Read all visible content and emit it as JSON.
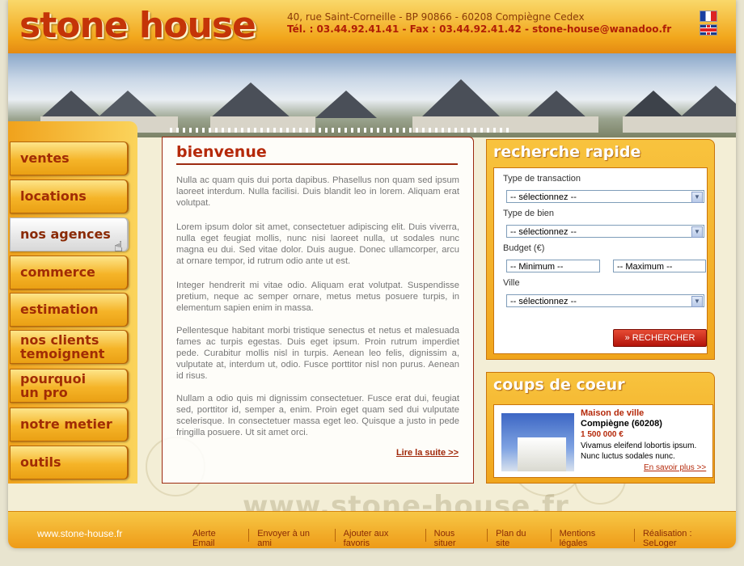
{
  "header": {
    "logo": "stone house",
    "address": "40, rue Saint-Corneille - BP 90866 - 60208 Compiègne Cedex",
    "contact": "Tél. : 03.44.92.41.41 - Fax : 03.44.92.41.42 - stone-house@wanadoo.fr",
    "flags": [
      "flag-fr",
      "flag-uk"
    ]
  },
  "nav": {
    "items": [
      {
        "label": "ventes"
      },
      {
        "label": "locations"
      },
      {
        "label": "nos agences"
      },
      {
        "label": "commerce"
      },
      {
        "label": "estimation"
      },
      {
        "label": "nos clients",
        "label2": "temoignent"
      },
      {
        "label": "pourquoi",
        "label2": "un pro"
      },
      {
        "label": "notre metier"
      },
      {
        "label": "outils"
      }
    ]
  },
  "main": {
    "title": "bienvenue",
    "paragraphs": [
      "Nulla ac quam quis dui porta dapibus. Phasellus non quam sed ipsum laoreet interdum. Nulla facilisi. Duis blandit leo in lorem. Aliquam erat volutpat.",
      "Lorem ipsum dolor sit amet, consectetuer adipiscing elit. Duis viverra, nulla eget feugiat mollis, nunc nisi laoreet nulla, ut sodales nunc magna eu dui. Sed vitae dolor. Duis augue. Donec ullamcorper, arcu at ornare tempor, id rutrum odio ante ut est.",
      "Integer hendrerit mi vitae odio. Aliquam erat volutpat. Suspendisse pretium, neque ac semper ornare, metus metus posuere turpis, in elementum sapien enim in massa.",
      "Pellentesque habitant morbi tristique senectus et netus et malesuada fames ac turpis egestas. Duis eget ipsum. Proin rutrum imperdiet pede. Curabitur mollis nisl in turpis. Aenean leo felis, dignissim a, vulputate at, interdum ut, odio. Fusce porttitor nisl non purus. Aenean id risus.",
      "Nullam a odio quis mi dignissim consectetuer. Fusce erat dui, feugiat sed, porttitor id, semper a, enim. Proin eget quam sed dui vulputate scelerisque. In consectetuer massa eget leo. Quisque a justo in pede fringilla posuere. Ut sit amet orci."
    ],
    "read_more": "Lire la suite >>"
  },
  "search": {
    "title": "recherche rapide",
    "transaction_label": "Type de transaction",
    "transaction_value": "-- sélectionnez --",
    "bien_label": "Type de bien",
    "bien_value": "-- sélectionnez --",
    "budget_label": "Budget (€)",
    "min_value": "-- Minimum --",
    "max_value": "-- Maximum --",
    "ville_label": "Ville",
    "ville_value": "-- sélectionnez --",
    "button": "RECHERCHER",
    "button_icon": "»"
  },
  "coup": {
    "title": "coups de coeur",
    "type": "Maison de ville",
    "city": "Compiègne (60208)",
    "price": "1 500 000 €",
    "desc1": "Vivamus eleifend lobortis ipsum.",
    "desc2": "Nunc luctus sodales nunc.",
    "link": "En savoir plus >>"
  },
  "footer": {
    "site": "www.stone-house.fr",
    "watermark": "www.stone-house.fr",
    "links": [
      "Alerte Email",
      "Envoyer à un ami",
      "Ajouter aux favoris",
      "Nous situer",
      "Plan du site",
      "Mentions légales",
      "Réalisation : SeLoger"
    ]
  },
  "colors": {
    "accent": "#f2a71c",
    "brand": "#c43408",
    "button": "#c8200e"
  }
}
